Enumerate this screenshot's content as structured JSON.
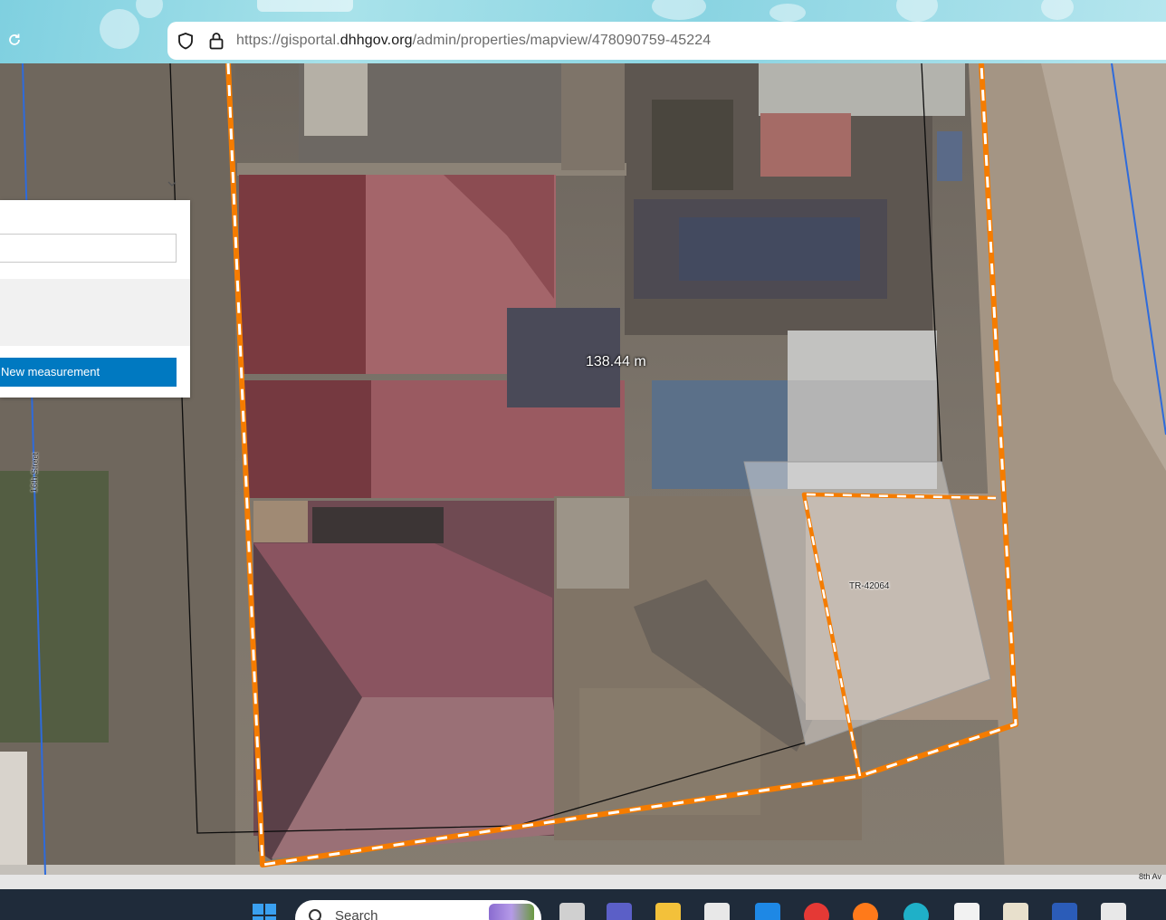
{
  "browser": {
    "url": {
      "prefix": "https://gisportal.",
      "domain": "dhhgov.org",
      "path": "/admin/properties/mapview/478090759-45224"
    },
    "icons": [
      "reload-icon",
      "shield-icon",
      "lock-icon"
    ]
  },
  "measure_panel": {
    "new_measurement_label": "New measurement",
    "unit_select_value": ""
  },
  "map": {
    "measurement_label": "138.44 m",
    "parcel_label": "TR-42064",
    "street_label": "16th Street",
    "corner_label": "8th Av",
    "boundary_color": "#f57c00"
  },
  "taskbar": {
    "search_placeholder": "Search",
    "icons": [
      "start-icon",
      "task-view-icon",
      "teams-icon",
      "file-explorer-icon",
      "store-icon",
      "mail-icon",
      "chrome-icon",
      "firefox-icon",
      "edge-icon",
      "document-icon",
      "image-icon",
      "word-icon",
      "app-icon"
    ]
  }
}
